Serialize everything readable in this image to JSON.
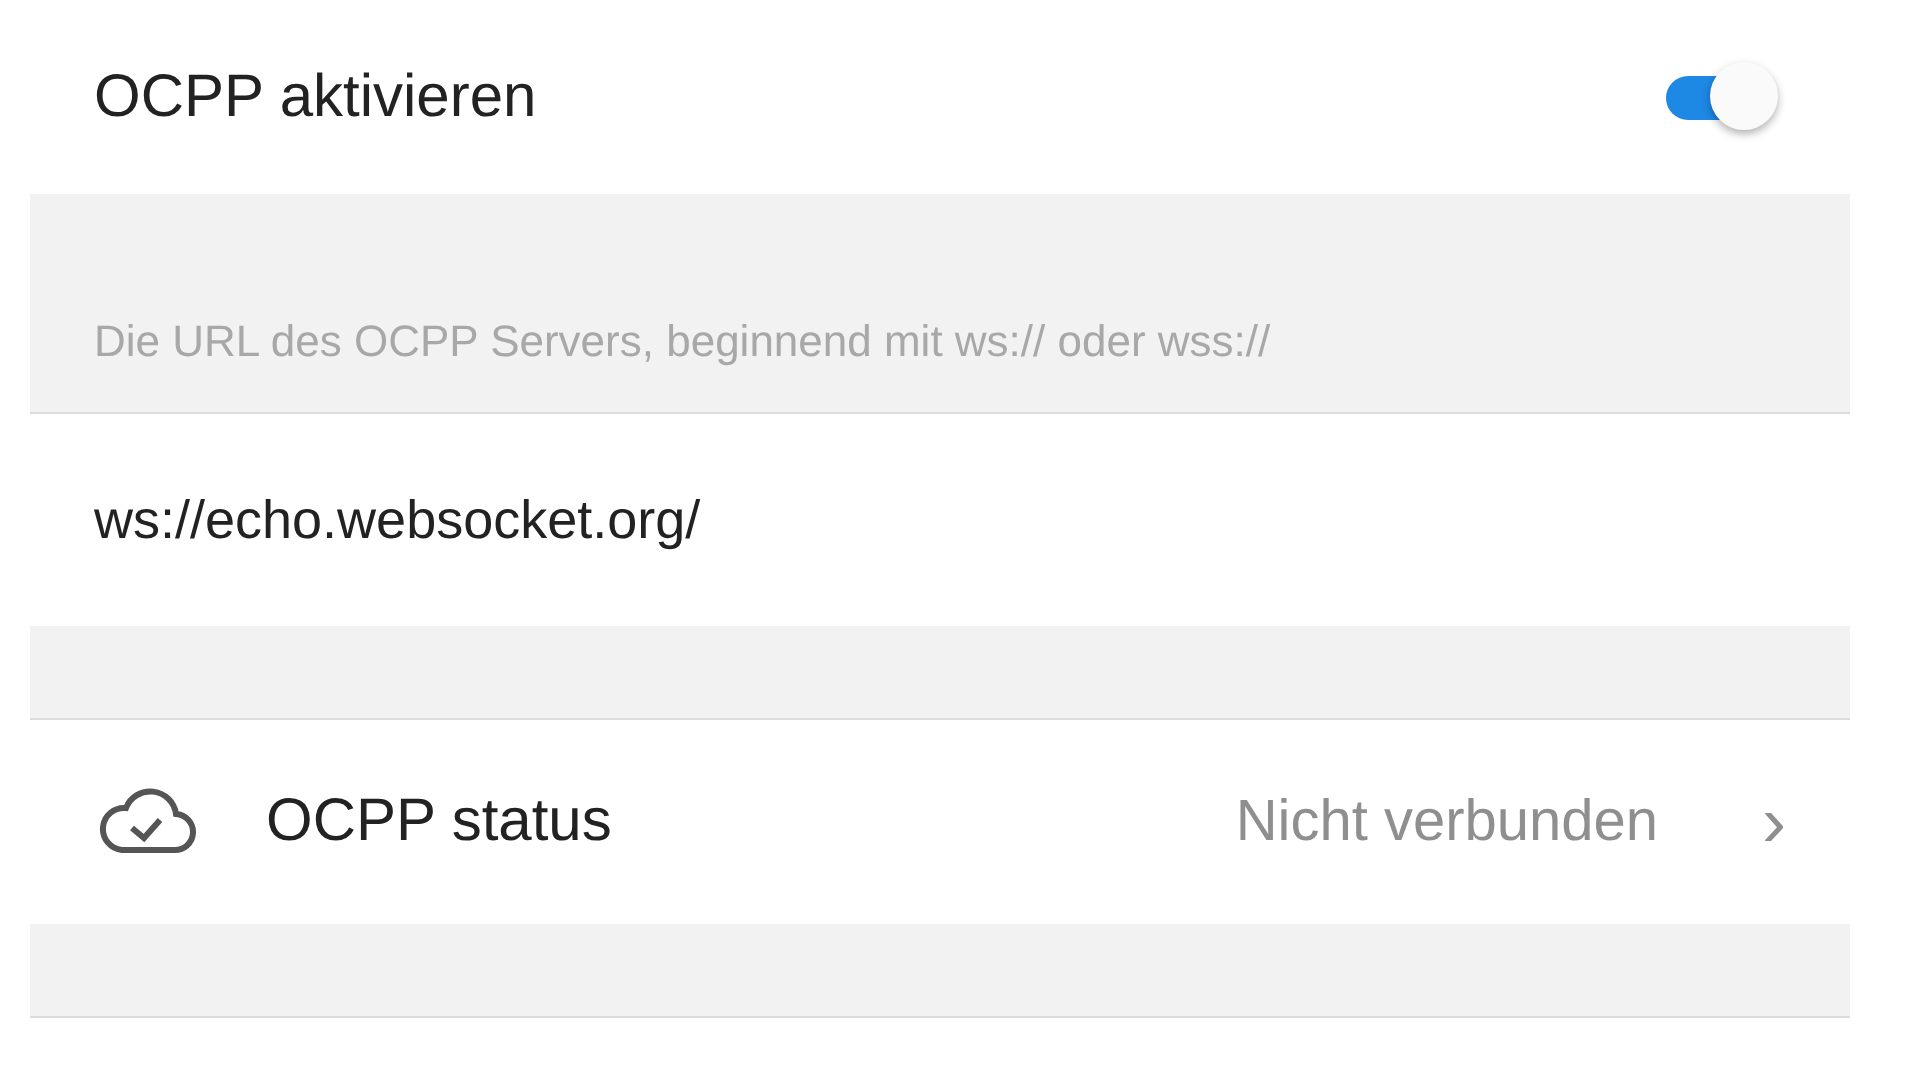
{
  "ocpp_toggle": {
    "label": "OCPP aktivieren",
    "on": true
  },
  "url_field": {
    "hint": "Die URL des OCPP Servers, beginnend mit ws:// oder wss://",
    "value": "ws://echo.websocket.org/"
  },
  "status_row": {
    "label": "OCPP status",
    "value": "Nicht verbunden",
    "chevron": "›"
  }
}
